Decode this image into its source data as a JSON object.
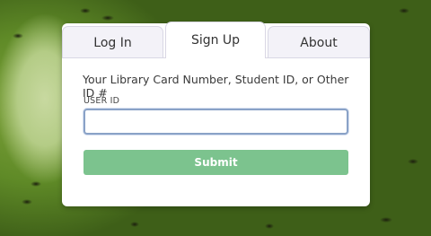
{
  "tabs": [
    {
      "label": "Log In",
      "active": false
    },
    {
      "label": "Sign Up",
      "active": true
    },
    {
      "label": "About",
      "active": false
    }
  ],
  "signup": {
    "prompt": "Your Library Card Number, Student ID, or Other ID #",
    "user_id_label": "USER ID",
    "user_id_value": "",
    "submit_label": "Submit"
  },
  "colors": {
    "submit_bg": "#7cc38e",
    "input_focus_border": "#8aa2c7",
    "tab_inactive_bg": "#f3f2f8"
  }
}
